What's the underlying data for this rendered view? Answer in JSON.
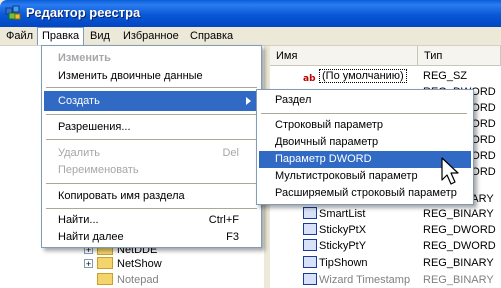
{
  "window": {
    "title": "Редактор реестра",
    "icon": "regedit-icon"
  },
  "menubar": {
    "items": [
      "Файл",
      "Правка",
      "Вид",
      "Избранное",
      "Справка"
    ],
    "open_item": "Правка"
  },
  "edit_menu": {
    "items": [
      {
        "label": "Изменить",
        "state": "disabled-bold"
      },
      {
        "label": "Изменить двоичные данные",
        "state": "enabled"
      },
      {
        "label": "Создать",
        "state": "highlighted",
        "submenu": true
      },
      {
        "label": "Разрешения...",
        "state": "enabled"
      },
      {
        "label": "Удалить",
        "shortcut": "Del",
        "state": "disabled"
      },
      {
        "label": "Переименовать",
        "state": "disabled"
      },
      {
        "label": "Копировать имя раздела",
        "state": "enabled"
      },
      {
        "label": "Найти...",
        "shortcut": "Ctrl+F",
        "state": "enabled"
      },
      {
        "label": "Найти далее",
        "shortcut": "F3",
        "state": "enabled"
      }
    ]
  },
  "create_submenu": {
    "items": [
      {
        "label": "Раздел"
      },
      {
        "label": "Строковый параметр"
      },
      {
        "label": "Двоичный параметр"
      },
      {
        "label": "Параметр DWORD",
        "highlighted": true
      },
      {
        "label": "Мультистроковый параметр"
      },
      {
        "label": "Расширяемый строковый параметр"
      }
    ]
  },
  "list_view": {
    "columns": [
      "Имя",
      "Тип"
    ],
    "rows": [
      {
        "name": "(По умолчанию)",
        "type": "REG_SZ",
        "icon": "string-value-icon"
      },
      {
        "name": "",
        "type": "REG_DWORD",
        "icon": "binary-value-icon"
      },
      {
        "name": "",
        "type": "REG_DWORD",
        "icon": "binary-value-icon"
      },
      {
        "name": "",
        "type": "REG_DWORD",
        "icon": "binary-value-icon"
      },
      {
        "name": "",
        "type": "REG_DWORD",
        "icon": "binary-value-icon"
      },
      {
        "name": "",
        "type": "REG_DWORD",
        "icon": "binary-value-icon"
      },
      {
        "name": "",
        "type": "REG_DWORD",
        "icon": "binary-value-icon"
      },
      {
        "name": "",
        "type": "REG_BINARY",
        "icon": "binary-value-icon"
      },
      {
        "name": "SmartList",
        "type": "REG_BINARY",
        "icon": "binary-value-icon"
      },
      {
        "name": "StickyPtX",
        "type": "REG_DWORD",
        "icon": "binary-value-icon"
      },
      {
        "name": "StickyPtY",
        "type": "REG_DWORD",
        "icon": "binary-value-icon"
      },
      {
        "name": "TipShown",
        "type": "REG_BINARY",
        "icon": "binary-value-icon"
      },
      {
        "name": "Wizard Timestamp",
        "type": "REG_BINARY",
        "icon": "binary-value-icon"
      }
    ]
  },
  "tree": {
    "items": [
      {
        "label": "NetDDE"
      },
      {
        "label": "NetShow"
      },
      {
        "label": "Notepad"
      }
    ]
  },
  "colors": {
    "highlight": "#316ac5",
    "titlebar": "#0858d6",
    "menu_border": "#7f9db9",
    "disabled_text": "#a7a6aa"
  }
}
